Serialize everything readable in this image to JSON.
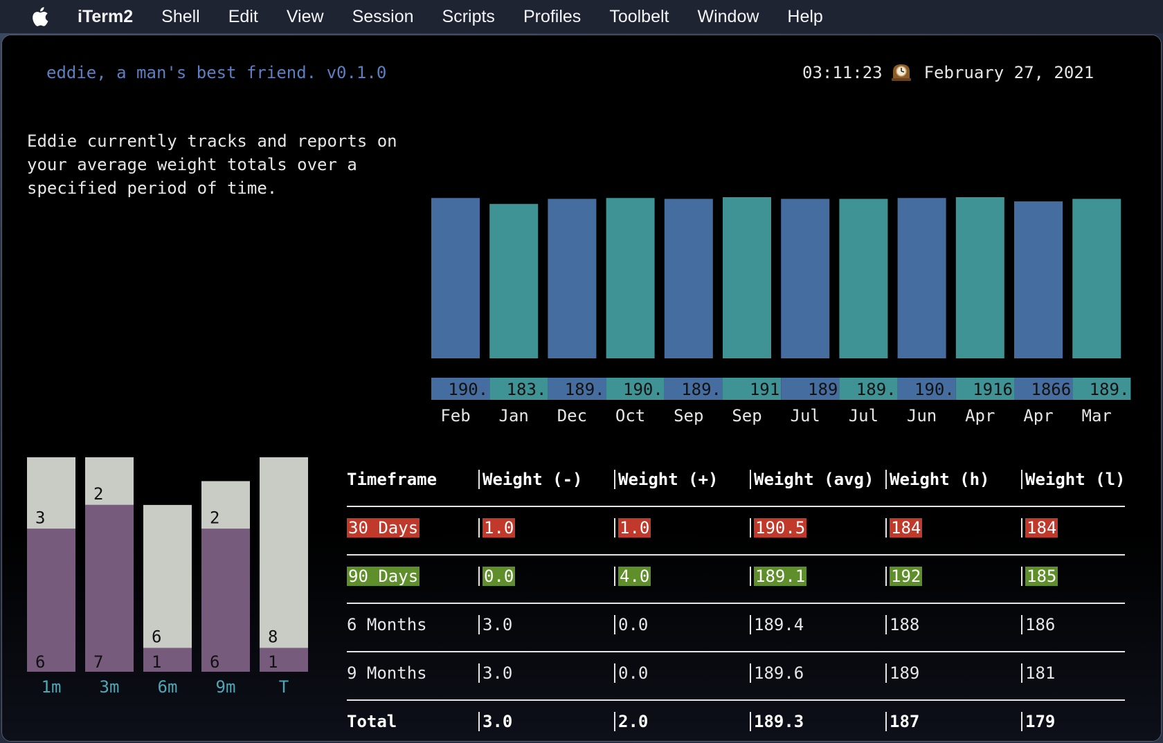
{
  "menubar": {
    "items": [
      "iTerm2",
      "Shell",
      "Edit",
      "View",
      "Session",
      "Scripts",
      "Profiles",
      "Toolbelt",
      "Window",
      "Help"
    ]
  },
  "header": {
    "app_title": "eddie, a man's best friend. v0.1.0",
    "time": "03:11:23",
    "date": "February 27, 2021",
    "clock_icon": "mantelpiece-clock-icon"
  },
  "description": "Eddie currently tracks and reports on\nyour average weight totals over a\nspecified period of time.",
  "colors": {
    "blue_bar": "#456d9f",
    "teal_bar": "#3f9394",
    "stack_light": "#c9cbc5",
    "stack_purple": "#775b7d",
    "highlight_red": "#c0392b",
    "highlight_green": "#5f8f2a",
    "title_blue": "#5d7fc2"
  },
  "chart_data": [
    {
      "type": "bar",
      "categories": [
        "Feb",
        "Jan",
        "Dec",
        "Oct",
        "Sep",
        "Sep",
        "Jul",
        "Jul",
        "Jun",
        "Apr",
        "Apr",
        "Mar"
      ],
      "values": [
        190,
        183,
        189,
        190,
        189,
        191,
        189,
        189,
        190,
        191,
        186,
        189
      ],
      "value_labels": [
        "190.",
        "183.",
        "189.",
        "190.",
        "189.",
        "191",
        "189",
        "189.",
        "190.",
        "1916",
        "1866",
        "189."
      ],
      "ylim": [
        0,
        191
      ]
    },
    {
      "type": "bar",
      "stacked": true,
      "categories": [
        "1m",
        "3m",
        "6m",
        "9m",
        "T"
      ],
      "series": [
        {
          "values": [
            6,
            7,
            1,
            6,
            1
          ]
        },
        {
          "values": [
            3,
            2,
            6,
            2,
            8
          ]
        }
      ],
      "ylim": [
        0,
        9
      ]
    }
  ],
  "table": {
    "headers": [
      "Timeframe",
      "Weight (-)",
      "Weight (+)",
      "Weight (avg)",
      "Weight (h)",
      "Weight (l)"
    ],
    "rows": [
      {
        "cells": [
          "30 Days",
          "1.0",
          "1.0",
          "190.5",
          "184",
          "184"
        ],
        "style": "red"
      },
      {
        "cells": [
          "90 Days",
          "0.0",
          "4.0",
          "189.1",
          "192",
          "185"
        ],
        "style": "green"
      },
      {
        "cells": [
          "6 Months",
          "3.0",
          "0.0",
          "189.4",
          "188",
          "186"
        ],
        "style": "plain"
      },
      {
        "cells": [
          "9 Months",
          "3.0",
          "0.0",
          "189.6",
          "189",
          "181"
        ],
        "style": "plain"
      },
      {
        "cells": [
          "Total",
          "3.0",
          "2.0",
          "189.3",
          "187",
          "179"
        ],
        "style": "bold"
      }
    ]
  }
}
